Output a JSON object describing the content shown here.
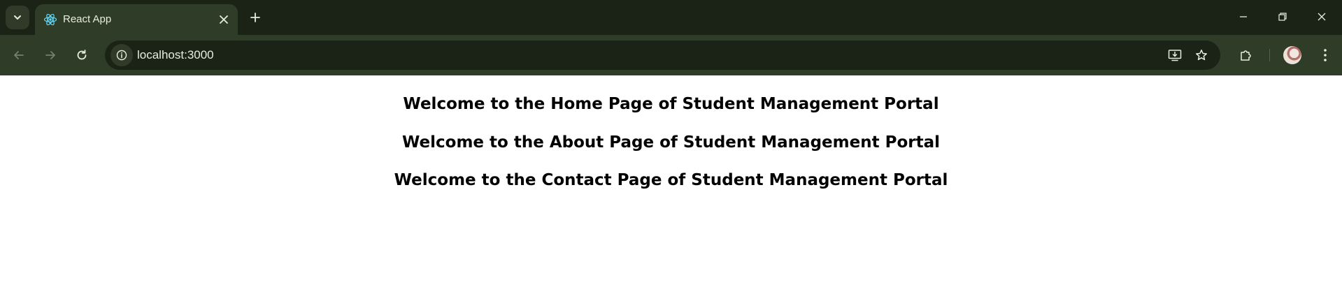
{
  "browser": {
    "tab": {
      "title": "React App",
      "favicon": "react-icon"
    },
    "address_bar": {
      "url": "localhost:3000"
    },
    "icons": {
      "tab_search": "chevron-down-icon",
      "close_tab": "close-icon",
      "new_tab": "plus-icon",
      "minimize": "minimize-icon",
      "restore": "restore-icon",
      "close_window": "close-icon",
      "back": "arrow-left-icon",
      "forward": "arrow-right-icon",
      "reload": "reload-icon",
      "site_info": "info-icon",
      "install_app": "install-icon",
      "bookmark": "star-icon",
      "extensions": "puzzle-icon",
      "profile": "avatar",
      "menu": "kebab-menu-icon"
    },
    "colors": {
      "tabstrip_bg": "#1b2316",
      "toolbar_bg": "#2f3c28",
      "omnibox_bg": "#1b2316",
      "text_light": "#e8ecdf",
      "react_blue": "#61dafb"
    }
  },
  "page": {
    "headings": [
      "Welcome to the Home Page of Student Management Portal",
      "Welcome to the About Page of Student Management Portal",
      "Welcome to the Contact Page of Student Management Portal"
    ]
  }
}
